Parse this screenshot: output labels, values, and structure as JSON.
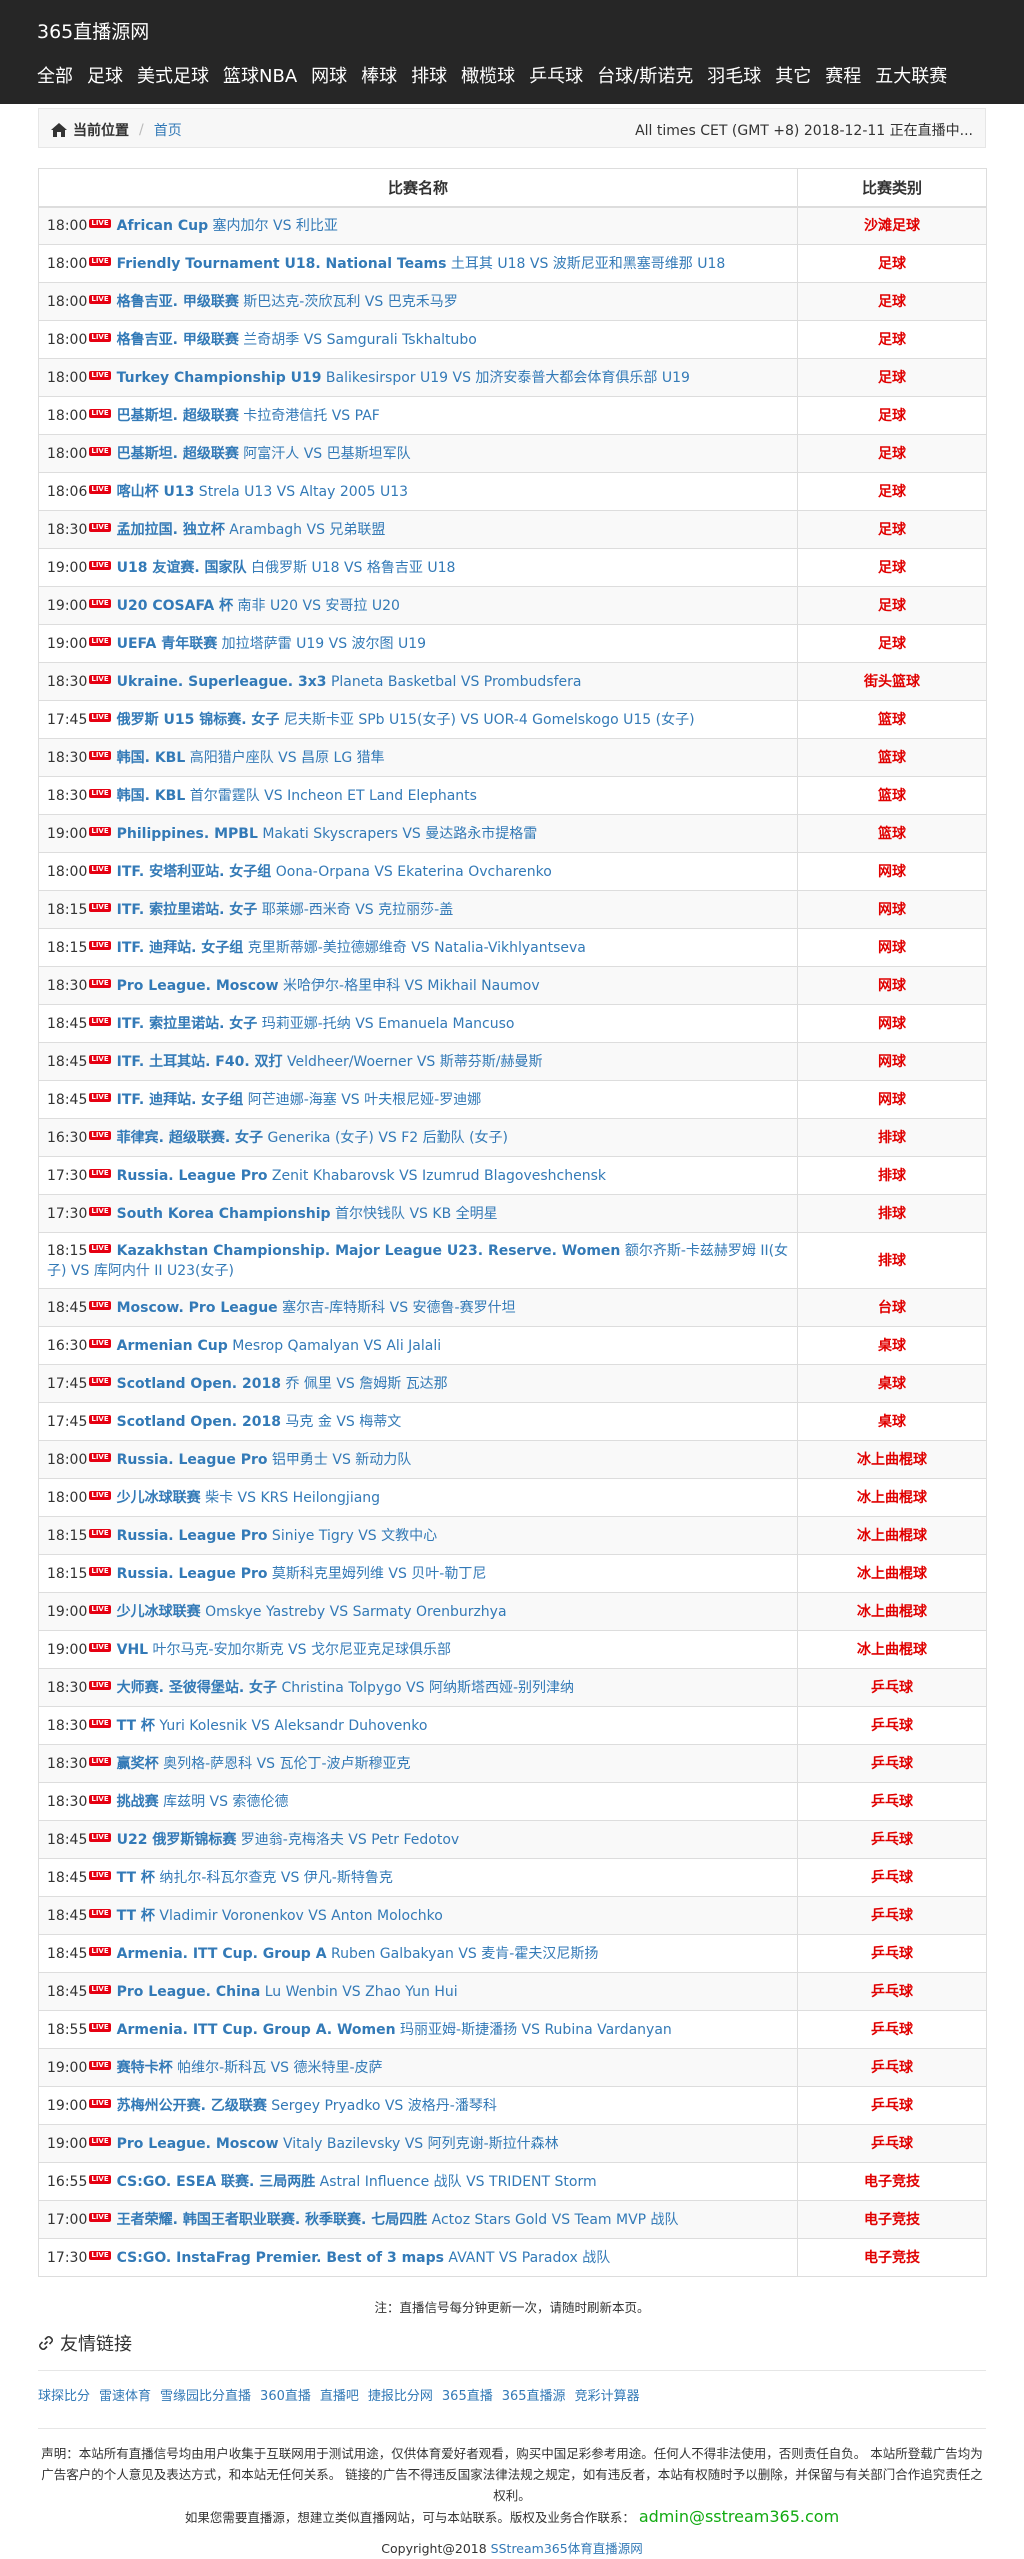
{
  "header": {
    "site_title": "365直播源网",
    "nav": [
      "全部",
      "足球",
      "美式足球",
      "篮球NBA",
      "网球",
      "棒球",
      "排球",
      "橄榄球",
      "乒乓球",
      "台球/斯诺克",
      "羽毛球",
      "其它",
      "赛程",
      "五大联赛"
    ]
  },
  "breadcrumb": {
    "current": "当前位置",
    "home": "首页",
    "timezone": "All times CET (GMT +8) 2018-12-11 正在直播中..."
  },
  "table": {
    "headers": [
      "比赛名称",
      "比赛类别"
    ],
    "live_badge": "LIVE",
    "rows": [
      {
        "time": "18:00",
        "league": "African Cup",
        "teams": " 塞内加尔 VS 利比亚",
        "cat": "沙滩足球"
      },
      {
        "time": "18:00",
        "league": "Friendly Tournament U18. National Teams",
        "teams": " 土耳其 U18 VS 波斯尼亚和黑塞哥维那 U18",
        "cat": "足球"
      },
      {
        "time": "18:00",
        "league": "格鲁吉亚. 甲级联赛",
        "teams": " 斯巴达克-茨欣瓦利 VS 巴克禾马罗",
        "cat": "足球"
      },
      {
        "time": "18:00",
        "league": "格鲁吉亚. 甲级联赛",
        "teams": " 兰奇胡季 VS Samgurali Tskhaltubo",
        "cat": "足球"
      },
      {
        "time": "18:00",
        "league": "Turkey Championship U19",
        "teams": " Balikesirspor U19 VS 加济安泰普大都会体育俱乐部 U19",
        "cat": "足球"
      },
      {
        "time": "18:00",
        "league": "巴基斯坦. 超级联赛",
        "teams": " 卡拉奇港信托 VS PAF",
        "cat": "足球"
      },
      {
        "time": "18:00",
        "league": "巴基斯坦. 超级联赛",
        "teams": " 阿富汗人 VS 巴基斯坦军队",
        "cat": "足球"
      },
      {
        "time": "18:06",
        "league": "喀山杯 U13",
        "teams": " Strela U13 VS Altay 2005 U13",
        "cat": "足球"
      },
      {
        "time": "18:30",
        "league": "孟加拉国. 独立杯",
        "teams": " Arambagh VS 兄弟联盟",
        "cat": "足球"
      },
      {
        "time": "19:00",
        "league": "U18 友谊赛. 国家队",
        "teams": " 白俄罗斯 U18 VS 格鲁吉亚 U18",
        "cat": "足球"
      },
      {
        "time": "19:00",
        "league": "U20 COSAFA 杯",
        "teams": " 南非 U20 VS 安哥拉 U20",
        "cat": "足球"
      },
      {
        "time": "19:00",
        "league": "UEFA 青年联赛",
        "teams": " 加拉塔萨雷 U19 VS 波尔图 U19",
        "cat": "足球"
      },
      {
        "time": "18:30",
        "league": "Ukraine. Superleague. 3x3",
        "teams": " Planeta Basketbal VS Prombudsfera",
        "cat": "街头篮球"
      },
      {
        "time": "17:45",
        "league": "俄罗斯 U15 锦标赛. 女子",
        "teams": " 尼夫斯卡亚 SPb U15(女子) VS UOR-4 Gomelskogo U15 (女子)",
        "cat": "篮球"
      },
      {
        "time": "18:30",
        "league": "韩国. KBL",
        "teams": " 高阳猎户座队 VS 昌原 LG 猎隼",
        "cat": "篮球"
      },
      {
        "time": "18:30",
        "league": "韩国. KBL",
        "teams": " 首尔雷霆队 VS Incheon ET Land Elephants",
        "cat": "篮球"
      },
      {
        "time": "19:00",
        "league": "Philippines. MPBL",
        "teams": " Makati Skyscrapers VS 曼达路永市提格雷",
        "cat": "篮球"
      },
      {
        "time": "18:00",
        "league": "ITF. 安塔利亚站. 女子组",
        "teams": " Oona-Orpana VS Ekaterina Ovcharenko",
        "cat": "网球"
      },
      {
        "time": "18:15",
        "league": "ITF. 索拉里诺站. 女子",
        "teams": " 耶莱娜-西米奇 VS 克拉丽莎-盖",
        "cat": "网球"
      },
      {
        "time": "18:15",
        "league": "ITF. 迪拜站. 女子组",
        "teams": " 克里斯蒂娜-美拉德娜维奇 VS Natalia-Vikhlyantseva",
        "cat": "网球"
      },
      {
        "time": "18:30",
        "league": "Pro League. Moscow",
        "teams": " 米哈伊尔-格里申科 VS Mikhail Naumov",
        "cat": "网球"
      },
      {
        "time": "18:45",
        "league": "ITF. 索拉里诺站. 女子",
        "teams": " 玛莉亚娜-托纳 VS Emanuela Mancuso",
        "cat": "网球"
      },
      {
        "time": "18:45",
        "league": "ITF. 土耳其站. F40. 双打",
        "teams": " Veldheer/Woerner VS 斯蒂芬斯/赫曼斯",
        "cat": "网球"
      },
      {
        "time": "18:45",
        "league": "ITF. 迪拜站. 女子组",
        "teams": " 阿芒迪娜-海塞 VS 叶夫根尼娅-罗迪娜",
        "cat": "网球"
      },
      {
        "time": "16:30",
        "league": "菲律宾. 超级联赛. 女子",
        "teams": " Generika (女子) VS F2 后勤队 (女子)",
        "cat": "排球"
      },
      {
        "time": "17:30",
        "league": "Russia. League Pro",
        "teams": " Zenit Khabarovsk VS Izumrud Blagoveshchensk",
        "cat": "排球"
      },
      {
        "time": "17:30",
        "league": "South Korea Championship",
        "teams": " 首尔快钱队 VS KB 全明星",
        "cat": "排球"
      },
      {
        "time": "18:15",
        "league": "Kazakhstan Championship. Major League U23. Reserve. Women",
        "teams": " 额尔齐斯-卡兹赫罗姆 II(女子) VS 库阿内什 II U23(女子)",
        "cat": "排球",
        "tall": true
      },
      {
        "time": "18:45",
        "league": "Moscow. Pro League",
        "teams": " 塞尔吉-库特斯科 VS 安德鲁-赛罗什坦",
        "cat": "台球"
      },
      {
        "time": "16:30",
        "league": "Armenian Cup",
        "teams": " Mesrop Qamalyan VS Ali Jalali",
        "cat": "桌球"
      },
      {
        "time": "17:45",
        "league": "Scotland Open. 2018",
        "teams": " 乔 佩里 VS 詹姆斯 瓦达那",
        "cat": "桌球"
      },
      {
        "time": "17:45",
        "league": "Scotland Open. 2018",
        "teams": " 马克 金 VS 梅蒂文",
        "cat": "桌球"
      },
      {
        "time": "18:00",
        "league": "Russia. League Pro",
        "teams": " 铝甲勇士 VS 新动力队",
        "cat": "冰上曲棍球"
      },
      {
        "time": "18:00",
        "league": "少儿冰球联赛",
        "teams": " 柴卡 VS KRS Heilongjiang",
        "cat": "冰上曲棍球"
      },
      {
        "time": "18:15",
        "league": "Russia. League Pro",
        "teams": " Siniye Tigry VS 文教中心",
        "cat": "冰上曲棍球"
      },
      {
        "time": "18:15",
        "league": "Russia. League Pro",
        "teams": " 莫斯科克里姆列维 VS 贝叶-勒丁尼",
        "cat": "冰上曲棍球"
      },
      {
        "time": "19:00",
        "league": "少儿冰球联赛",
        "teams": " Omskye Yastreby VS Sarmaty Orenburzhya",
        "cat": "冰上曲棍球"
      },
      {
        "time": "19:00",
        "league": "VHL",
        "teams": " 叶尔马克-安加尔斯克 VS 戈尔尼亚克足球俱乐部",
        "cat": "冰上曲棍球"
      },
      {
        "time": "18:30",
        "league": "大师赛. 圣彼得堡站. 女子",
        "teams": " Christina Tolpygo VS 阿纳斯塔西娅-别列津纳",
        "cat": "乒乓球"
      },
      {
        "time": "18:30",
        "league": "TT 杯",
        "teams": " Yuri Kolesnik VS Aleksandr Duhovenko",
        "cat": "乒乓球"
      },
      {
        "time": "18:30",
        "league": "赢奖杯",
        "teams": " 奥列格-萨恩科 VS 瓦伦丁-波卢斯穆亚克",
        "cat": "乒乓球"
      },
      {
        "time": "18:30",
        "league": "挑战赛",
        "teams": " 库兹明 VS 索德伦德",
        "cat": "乒乓球"
      },
      {
        "time": "18:45",
        "league": "U22 俄罗斯锦标赛",
        "teams": " 罗迪翁-克梅洛夫 VS Petr Fedotov",
        "cat": "乒乓球"
      },
      {
        "time": "18:45",
        "league": "TT 杯",
        "teams": " 纳扎尔-科瓦尔查克 VS 伊凡-斯特鲁克",
        "cat": "乒乓球"
      },
      {
        "time": "18:45",
        "league": "TT 杯",
        "teams": " Vladimir Voronenkov VS Anton Molochko",
        "cat": "乒乓球"
      },
      {
        "time": "18:45",
        "league": "Armenia. ITT Cup. Group A",
        "teams": " Ruben Galbakyan VS 麦肯-霍夫汉尼斯扬",
        "cat": "乒乓球"
      },
      {
        "time": "18:45",
        "league": "Pro League. China",
        "teams": " Lu Wenbin VS Zhao Yun Hui",
        "cat": "乒乓球"
      },
      {
        "time": "18:55",
        "league": "Armenia. ITT Cup. Group A. Women",
        "teams": " 玛丽亚姆-斯捷潘扬 VS Rubina Vardanyan",
        "cat": "乒乓球"
      },
      {
        "time": "19:00",
        "league": "赛特卡杯",
        "teams": " 帕维尔-斯科瓦 VS 德米特里-皮萨",
        "cat": "乒乓球"
      },
      {
        "time": "19:00",
        "league": "苏梅州公开赛. 乙级联赛",
        "teams": " Sergey Pryadko VS 波格丹-潘琴科",
        "cat": "乒乓球"
      },
      {
        "time": "19:00",
        "league": "Pro League. Moscow",
        "teams": " Vitaly Bazilevsky VS 阿列克谢-斯拉什森林",
        "cat": "乒乓球"
      },
      {
        "time": "16:55",
        "league": "CS:GO. ESEA 联赛. 三局两胜",
        "teams": " Astral Influence 战队 VS TRIDENT Storm",
        "cat": "电子竞技"
      },
      {
        "time": "17:00",
        "league": "王者荣耀. 韩国王者职业联赛. 秋季联赛. 七局四胜",
        "teams": " Actoz Stars Gold VS Team MVP 战队",
        "cat": "电子竞技"
      },
      {
        "time": "17:30",
        "league": "CS:GO. InstaFrag Premier. Best of 3 maps",
        "teams": " AVANT VS Paradox 战队",
        "cat": "电子竞技"
      }
    ]
  },
  "note": "注：直播信号每分钟更新一次，请随时刷新本页。",
  "friends": {
    "title": "友情链接",
    "links": [
      "球探比分",
      "雷速体育",
      "雪缘园比分直播",
      "360直播",
      "直播吧",
      "捷报比分网",
      "365直播",
      "365直播源",
      "竞彩计算器"
    ]
  },
  "footer": {
    "line1": "声明：本站所有直播信号均由用户收集于互联网用于测试用途，仅供体育爱好者观看，购买中国足彩参考用途。任何人不得非法使用，否则责任自负。 本站所登载广告均为广告客户的个人意见及表达方式，和本站无任何关系。 链接的广告不得违反国家法律法规之规定，如有违反者，本站有权随时予以删除，并保留与有关部门合作追究责任之权利。",
    "line2": "如果您需要直播源，想建立类似直播网站，可与本站联系。版权及业务合作联系：",
    "email": "admin@sstream365.com",
    "copyright": "Copyright@2018 ",
    "copyright_link": "SStream365体育直播源网"
  },
  "colors": {
    "header_bg": "#262626",
    "link": "#337ab7",
    "category": "#e00000",
    "live_badge": "#e60012",
    "email": "#11aa11"
  }
}
